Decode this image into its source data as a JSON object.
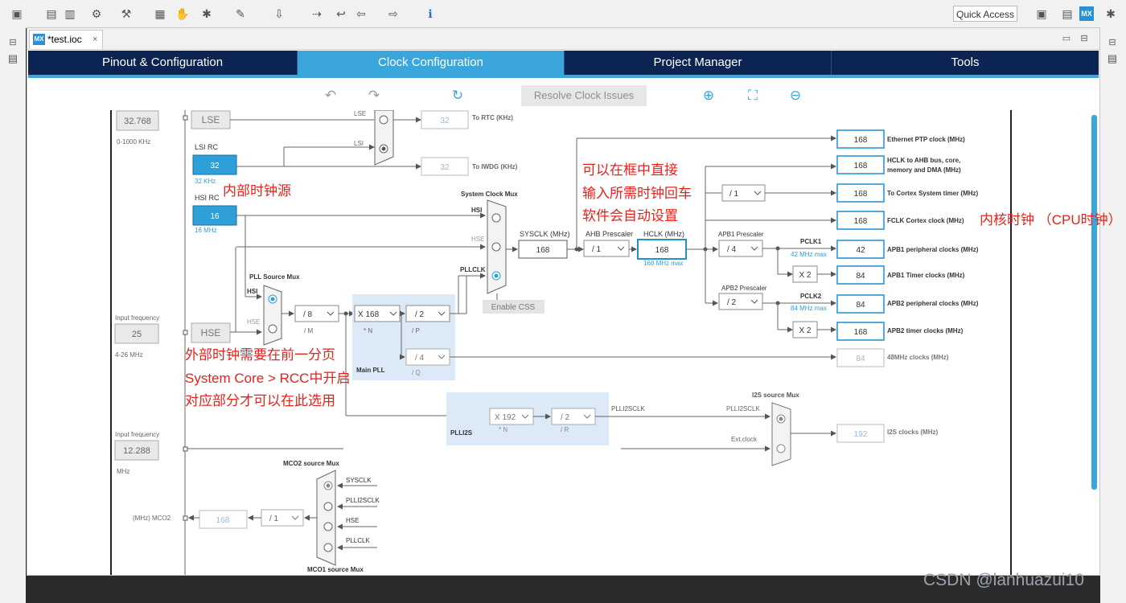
{
  "toolbar": {
    "quick_access": "Quick Access"
  },
  "editor": {
    "tab_label": "*test.ioc",
    "tab_badge": "MX",
    "tab_close": "×"
  },
  "nav": {
    "tabs": [
      "Pinout & Configuration",
      "Clock Configuration",
      "Project Manager",
      "Tools"
    ],
    "active_index": 1
  },
  "actions": {
    "resolve_label": "Resolve Clock Issues"
  },
  "clock": {
    "lse": {
      "freq": "32.768",
      "range": "0-1000 KHz",
      "label": "LSE"
    },
    "lsi": {
      "label": "LSI RC",
      "value": "32",
      "unit": "32 KHz"
    },
    "hsi": {
      "label": "HSI RC",
      "value": "16",
      "unit": "16 MHz"
    },
    "hse": {
      "input_label": "Input frequency",
      "freq": "25",
      "range": "4-26 MHz",
      "label": "HSE"
    },
    "mux_labels": {
      "lse": "LSE",
      "lsi": "LSI",
      "hsi": "HSI",
      "hse": "HSE",
      "pllclk": "PLLCLK"
    },
    "rtc": {
      "value": "32",
      "label": "To RTC (KHz)"
    },
    "iwdg": {
      "value": "32",
      "label": "To IWDG (KHz)"
    },
    "system_mux": "System Clock Mux",
    "pll_mux": "PLL Source Mux",
    "main_pll": "Main PLL",
    "pll": {
      "m": "/ 8",
      "m_label": "/ M",
      "n": "X 168",
      "n_label": "* N",
      "p": "/ 2",
      "p_label": "/ P",
      "q": "/ 4",
      "q_label": "/ Q"
    },
    "enable_css": "Enable CSS",
    "sysclk": {
      "label": "SYSCLK (MHz)",
      "value": "168"
    },
    "ahb": {
      "label": "AHB Prescaler",
      "value": "/ 1"
    },
    "hclk": {
      "label": "HCLK (MHz)",
      "value": "168",
      "max": "168 MHz max"
    },
    "systick_div": "/ 1",
    "apb1": {
      "label": "APB1 Prescaler",
      "value": "/ 4",
      "pclk": "PCLK1",
      "max": "42 MHz max"
    },
    "apb2": {
      "label": "APB2 Prescaler",
      "value": "/ 2",
      "pclk": "PCLK2",
      "max": "84 MHz max"
    },
    "mult": "X 2",
    "outputs": [
      {
        "value": "168",
        "label": "Ethernet PTP clock (MHz)"
      },
      {
        "value": "168",
        "label": "HCLK to AHB bus, core,",
        "label2": "memory and DMA (MHz)"
      },
      {
        "value": "168",
        "label": "To Cortex System timer (MHz)"
      },
      {
        "value": "168",
        "label": "FCLK Cortex clock (MHz)"
      },
      {
        "value": "42",
        "label": "APB1 peripheral clocks (MHz)"
      },
      {
        "value": "84",
        "label": "APB1 Timer clocks (MHz)"
      },
      {
        "value": "84",
        "label": "APB2 peripheral clocks (MHz)"
      },
      {
        "value": "168",
        "label": "APB2 timer clocks (MHz)"
      },
      {
        "value": "84",
        "label": "48MHz clocks (MHz)"
      }
    ],
    "plli2s": {
      "label": "PLLI2S",
      "n": "X 192",
      "n_label": "* N",
      "r": "/ 2",
      "r_label": "/ R",
      "clk_label": "PLLI2SCLK"
    },
    "i2s": {
      "mux": "I2S source Mux",
      "in1": "PLLI2SCLK",
      "in2": "Ext.clock",
      "value": "192",
      "label": "I2S clocks (MHz)"
    },
    "ext": {
      "input_label": "Input frequency",
      "freq": "12.288",
      "unit": "MHz"
    },
    "mco2": {
      "mux": "MCO2 source Mux",
      "inputs": [
        "SYSCLK",
        "PLLI2SCLK",
        "HSE",
        "PLLCLK"
      ],
      "div": "/ 1",
      "value": "168",
      "label": "(MHz) MCO2"
    },
    "mco1_mux": "MCO1 source Mux"
  },
  "annotations": {
    "internal": "内部时钟源",
    "direct_input": [
      "可以在框中直接",
      "输入所需时钟回车",
      "软件会自动设置"
    ],
    "core_clock": "内核时钟 （CPU时钟）",
    "external": [
      "外部时钟需要在前一分页",
      "System Core > RCC中开启",
      "对应部分才可以在此选用"
    ]
  },
  "watermark": "CSDN @lanhuazui10",
  "colors": {
    "nav_bg": "#0b2452",
    "accent": "#3aa6dc",
    "annotation": "#e8211b",
    "value_box": "#1f8fd0"
  }
}
